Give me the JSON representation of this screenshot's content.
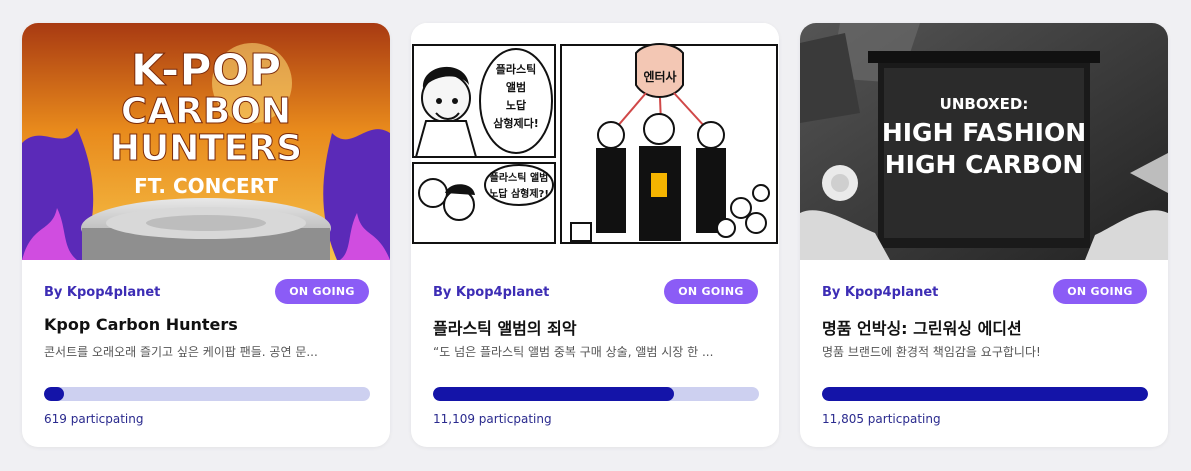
{
  "cards": [
    {
      "author": "By Kpop4planet",
      "status": "ON GOING",
      "title": "Kpop Carbon Hunters",
      "description": "콘서트를 오래오래 즐기고 싶은 케이팝 팬들. 공연 문...",
      "progress_fraction": 0.06,
      "participants": "619 particpating",
      "image": {
        "line1": "K-POP",
        "line2": "CARBON",
        "line3": "HUNTERS",
        "line4": "FT. CONCERT"
      }
    },
    {
      "author": "By Kpop4planet",
      "status": "ON GOING",
      "title": "플라스틱 앨범의 죄악",
      "description": "“도 넘은 플라스틱 앨범 중복 구매 상술, 앨범 시장 한 ...",
      "progress_fraction": 0.74,
      "participants": "11,109 particpating",
      "image": {
        "bubble1": [
          "플라스틱",
          "앨범",
          "노답",
          "삼형제다!"
        ],
        "bubble2": [
          "플라스틱 앨범",
          "노답 삼형제?!"
        ],
        "sign": "엔터사"
      }
    },
    {
      "author": "By Kpop4planet",
      "status": "ON GOING",
      "title": "명품 언박싱: 그린워싱 에디션",
      "description": "명품 브랜드에 환경적 책임감을 요구합니다!",
      "progress_fraction": 1.0,
      "participants": "11,805 particpating",
      "image": {
        "line1": "UNBOXED:",
        "line2": "HIGH FASHION",
        "line3": "HIGH CARBON"
      }
    }
  ],
  "colors": {
    "accent": "#8b5cf6",
    "author": "#3d2db5",
    "progress_fill": "#1414a8",
    "progress_track": "#cdd0f0"
  }
}
